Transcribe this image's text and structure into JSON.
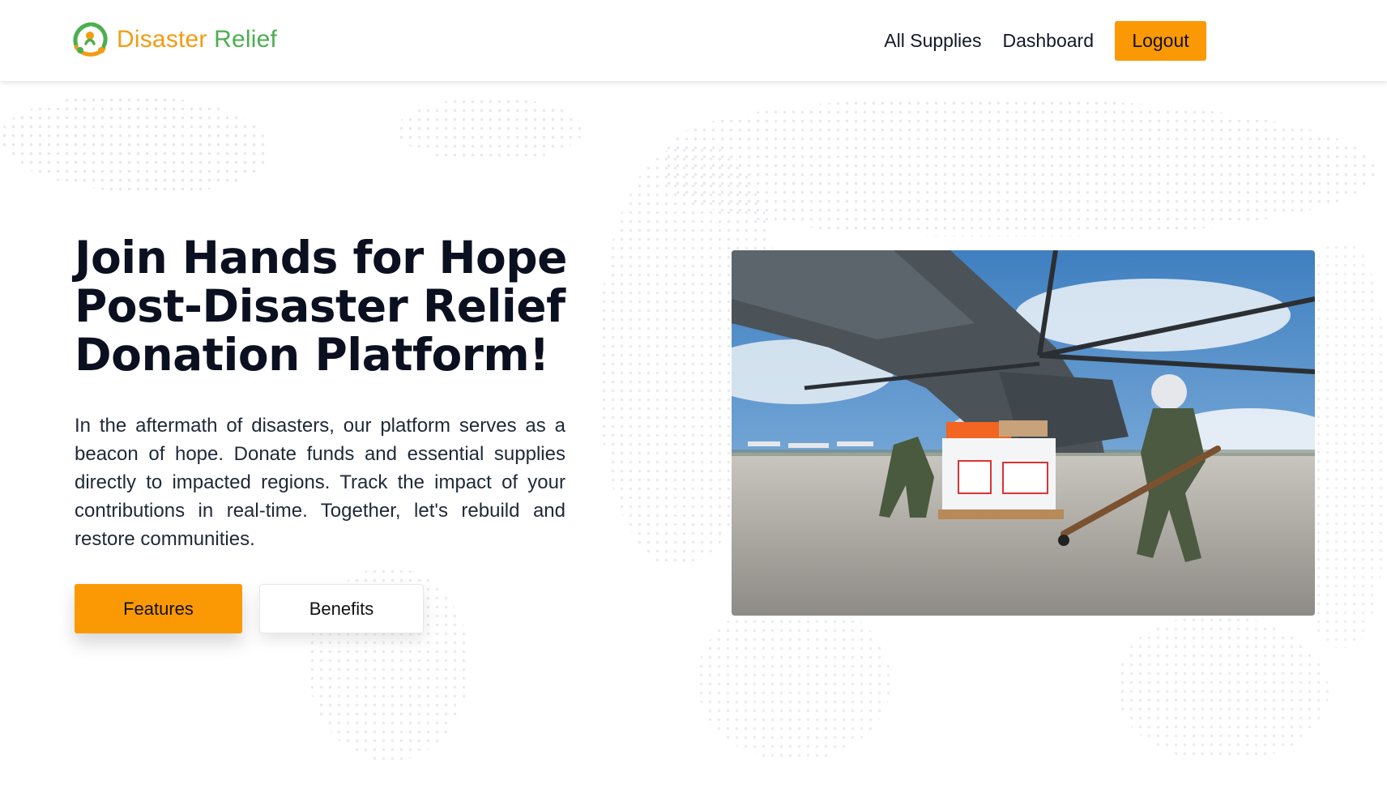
{
  "header": {
    "brand": {
      "name_first": "Disaster",
      "name_second": " Relief",
      "logo_icon": "people-circle-logo-icon"
    },
    "nav": [
      {
        "label": "All Supplies"
      },
      {
        "label": "Dashboard"
      }
    ],
    "logout_label": "Logout"
  },
  "hero": {
    "title_lines": [
      "Join Hands for Hope",
      "Post-Disaster Relief",
      "Donation Platform!"
    ],
    "description": "In the aftermath of disasters, our platform serves as a beacon of hope. Donate funds and essential supplies directly to impacted regions. Track the impact of your contributions in real-time. Together, let's rebuild and restore communities.",
    "features_label": "Features",
    "benefits_label": "Benefits"
  },
  "colors": {
    "accent": "#fb9904",
    "brand_green": "#4caf50",
    "brand_orange": "#f39c12",
    "text_dark": "#0b1020"
  }
}
